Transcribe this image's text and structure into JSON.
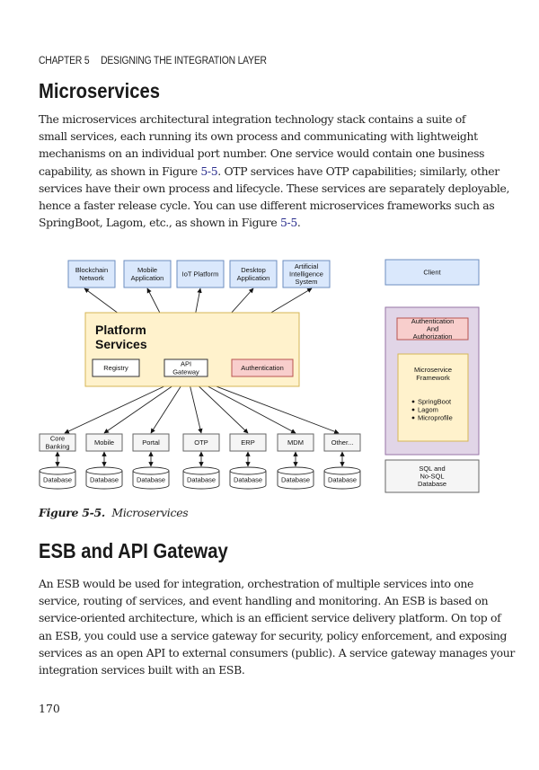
{
  "header": {
    "chapter": "CHAPTER 5",
    "chapter_title": "DESIGNING THE INTEGRATION LAYER"
  },
  "section1": {
    "title": "Microservices",
    "paragraph_lines": [
      [
        "The microservices architectural integration technology stack contains a suite of"
      ],
      [
        "small services, each running its own process and communicating with lightweight"
      ],
      [
        "mechanisms on an individual port number. One service would contain one business"
      ],
      [
        "capability, as shown in Figure ",
        "5-5",
        ". OTP services have OTP capabilities; similarly, other"
      ],
      [
        "services have their own process and lifecycle. These services are separately deployable,"
      ],
      [
        "hence a faster release cycle. You can use different microservices frameworks such as"
      ],
      [
        "SpringBoot, Lagom, etc., as shown in Figure ",
        "5-5",
        "."
      ]
    ]
  },
  "figure": {
    "top_clients": [
      [
        "Blockchain",
        "Network"
      ],
      [
        "Mobile",
        "Application"
      ],
      [
        "IoT Platform"
      ],
      [
        "Desktop",
        "Application"
      ],
      [
        "Artificial",
        "Intelligence",
        "System"
      ]
    ],
    "platform": {
      "title_lines": [
        "Platform",
        "Services"
      ],
      "registry": "Registry",
      "gateway": [
        "API",
        "Gateway"
      ],
      "authentication": "Authentication"
    },
    "services": [
      [
        "Core",
        "Banking"
      ],
      [
        "Mobile"
      ],
      [
        "Portal"
      ],
      [
        "OTP"
      ],
      [
        "ERP"
      ],
      [
        "MDM"
      ],
      [
        "Other..."
      ]
    ],
    "database_label": "Database",
    "legend": {
      "client": "Client",
      "auth": [
        "Authentication",
        "And",
        "Authorization"
      ],
      "framework_title": [
        "Microservice",
        "Framework"
      ],
      "framework_items": [
        "SpringBoot",
        "Lagom",
        "Microprofile"
      ],
      "db": [
        "SQL and",
        "No-SQL",
        "Database"
      ]
    },
    "colors": {
      "client_fill": "#dae8fc",
      "client_stroke": "#6c8ebf",
      "platform_fill": "#fff2cc",
      "platform_stroke": "#d6b656",
      "auth_fill": "#f8cecc",
      "auth_stroke": "#b85450",
      "framework_outer_fill": "#e1d5e7",
      "framework_outer_stroke": "#9673a6",
      "service_fill": "#f5f5f5",
      "service_stroke": "#666666"
    },
    "caption_label": "Figure 5-5.",
    "caption_text": "Microservices"
  },
  "section2": {
    "title": "ESB and API Gateway",
    "paragraph_lines": [
      "An ESB would be used for integration, orchestration of multiple services into one",
      "service, routing of services, and event handling and monitoring. An ESB is based on",
      "service-oriented architecture, which is an efficient service delivery platform. On top of",
      "an ESB, you could use a service gateway for security, policy enforcement, and exposing",
      "services as an open API to external consumers (public). A service gateway manages your",
      "integration services built with an ESB."
    ]
  },
  "footer": {
    "page_number": "170"
  }
}
